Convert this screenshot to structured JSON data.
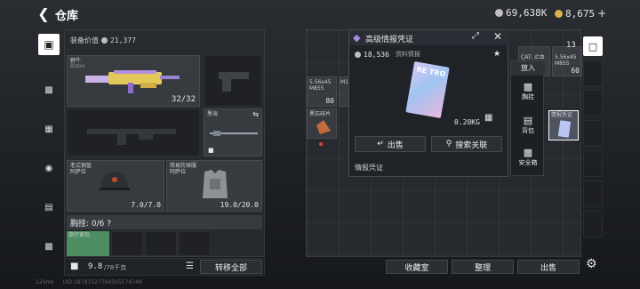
{
  "header": {
    "title": "仓库",
    "currency1": "69,638K",
    "currency2": "8,675",
    "plus": "+"
  },
  "equipment": {
    "value_label": "装备价值",
    "value": "21,377",
    "primary_weapon": {
      "name": "野牛",
      "sub": "Bizon",
      "ammo": "32/32"
    },
    "pistol_slot": "手枪",
    "melee_slot": {
      "name": "黑海"
    },
    "helmet": {
      "name": "老式钢盔",
      "level": "阿萨拉",
      "durability": "7.0/7.0"
    },
    "armor": {
      "name": "简易防弹服",
      "level": "阿萨拉",
      "durability": "19.0/20.0"
    },
    "chest_rig_label": "胸挂: 0/6 ?",
    "backpack_name": "旅行背包"
  },
  "capacity": {
    "value": "9.8",
    "max": "/78千克"
  },
  "buttons": {
    "transfer_all": "转移全部",
    "collection": "收藏室",
    "sort": "整理",
    "sell": "出售"
  },
  "stash_items": [
    {
      "label": "5.56x45 M855"
    },
    {
      "label": "M14"
    },
    {
      "label": "黑石碎片"
    },
    {
      "label": "CAT: 止血带"
    },
    {
      "label": "5.56x45 M855"
    },
    {
      "label": "情报凭证"
    },
    {
      "label": "60"
    },
    {
      "label": "80"
    },
    {
      "label": "13"
    }
  ],
  "popup": {
    "title": "高级情报凭证",
    "price": "18,536",
    "category": "资料情报",
    "weight": "0.20KG",
    "sell_button": "出售",
    "search_button": "搜索关联",
    "description": "情报凭证",
    "card_text": "RE TRO"
  },
  "context_menu": {
    "put_in": "放入",
    "chest": "胸挂",
    "backpack": "背包",
    "safe_box": "安全箱"
  },
  "footer": {
    "ping": "124ms",
    "uid": "UID:18781527764505174748"
  },
  "colors": {
    "accent": "#d9b24a",
    "selected": "#6e7dd6",
    "popup_bg": "#1f2227"
  }
}
